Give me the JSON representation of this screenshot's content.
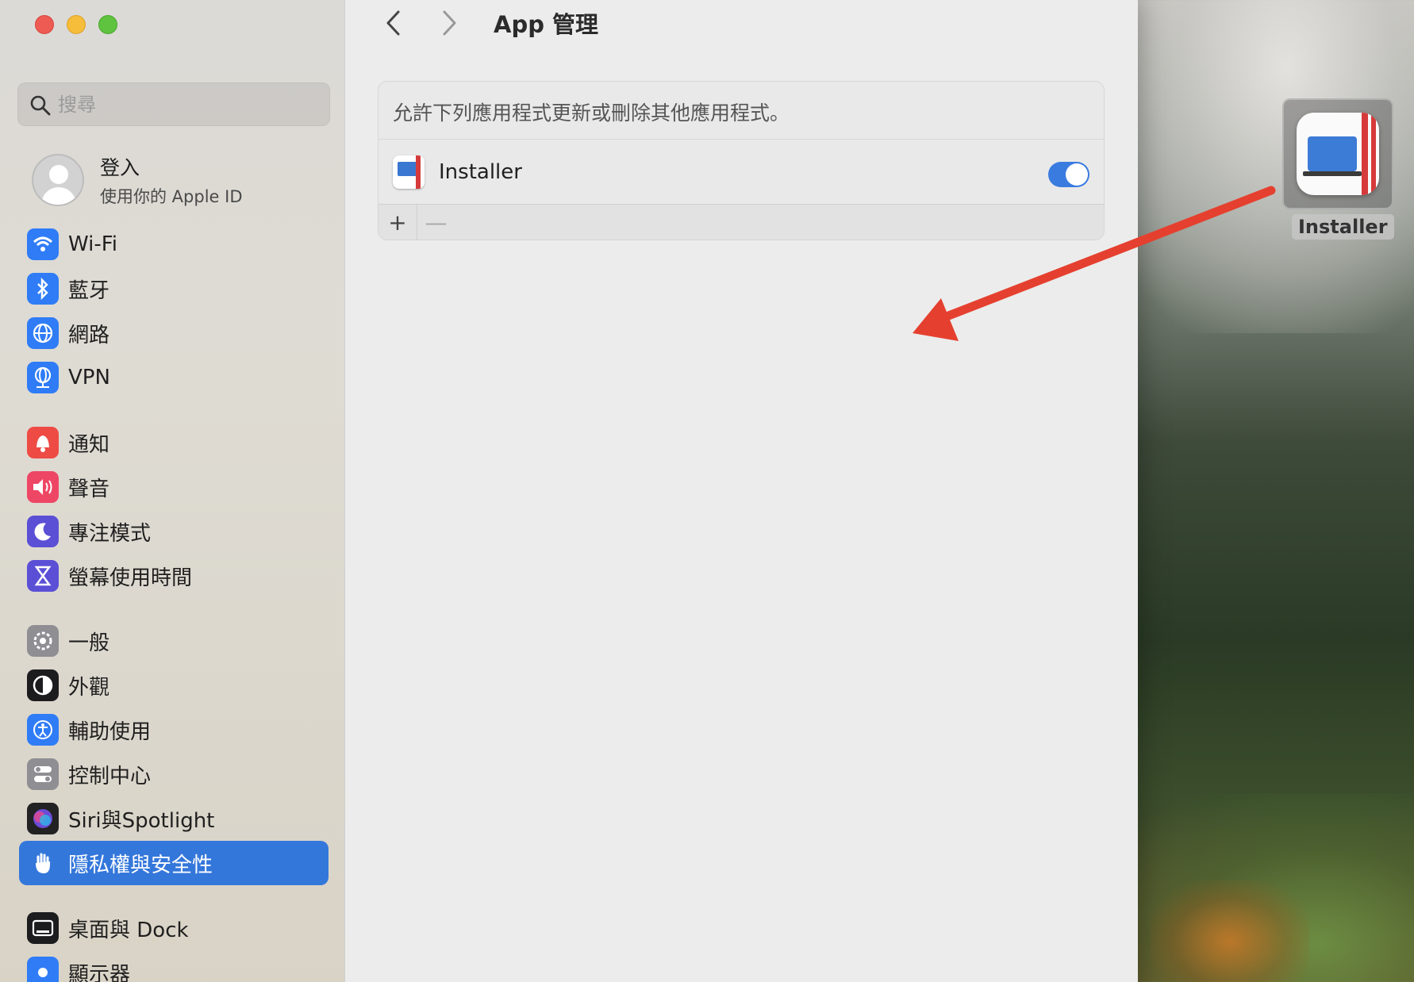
{
  "window": {
    "page_title": "App 管理"
  },
  "search": {
    "placeholder": "搜尋"
  },
  "account": {
    "name": "登入",
    "subtitle": "使用你的 Apple ID"
  },
  "sidebar": {
    "items": [
      {
        "label": "Wi-Fi",
        "icon": "wifi-icon",
        "color": "#2f7cf6"
      },
      {
        "label": "藍牙",
        "icon": "bluetooth-icon",
        "color": "#2f7cf6"
      },
      {
        "label": "網路",
        "icon": "globe-icon",
        "color": "#2f7cf6"
      },
      {
        "label": "VPN",
        "icon": "vpn-globe-icon",
        "color": "#2f7cf6"
      },
      {
        "label": "通知",
        "icon": "bell-icon",
        "color": "#ee4b45"
      },
      {
        "label": "聲音",
        "icon": "speaker-icon",
        "color": "#ee4766"
      },
      {
        "label": "專注模式",
        "icon": "moon-icon",
        "color": "#5b4fd6"
      },
      {
        "label": "螢幕使用時間",
        "icon": "hourglass-icon",
        "color": "#5b4fd6"
      },
      {
        "label": "一般",
        "icon": "gear-icon",
        "color": "#8e8e93"
      },
      {
        "label": "外觀",
        "icon": "appearance-icon",
        "color": "#1c1c1e"
      },
      {
        "label": "輔助使用",
        "icon": "accessibility-icon",
        "color": "#2f7cf6"
      },
      {
        "label": "控制中心",
        "icon": "control-center-icon",
        "color": "#8e8e93"
      },
      {
        "label": "Siri與Spotlight",
        "icon": "siri-icon",
        "color": "#222"
      },
      {
        "label": "隱私權與安全性",
        "icon": "hand-icon",
        "color": "#3477db",
        "active": true
      },
      {
        "label": "桌面與 Dock",
        "icon": "dock-icon",
        "color": "#1c1c1e"
      },
      {
        "label": "顯示器",
        "icon": "display-icon",
        "color": "#2f7cf6"
      }
    ]
  },
  "panel": {
    "description": "允許下列應用程式更新或刪除其他應用程式。",
    "apps": [
      {
        "name": "Installer",
        "enabled": true
      }
    ],
    "add_label": "+",
    "remove_label": "—"
  },
  "desktop": {
    "icon_label": "Installer"
  },
  "colors": {
    "accent": "#3477db",
    "toggle_on": "#3a7be0",
    "annotation_arrow": "#e5402f"
  }
}
